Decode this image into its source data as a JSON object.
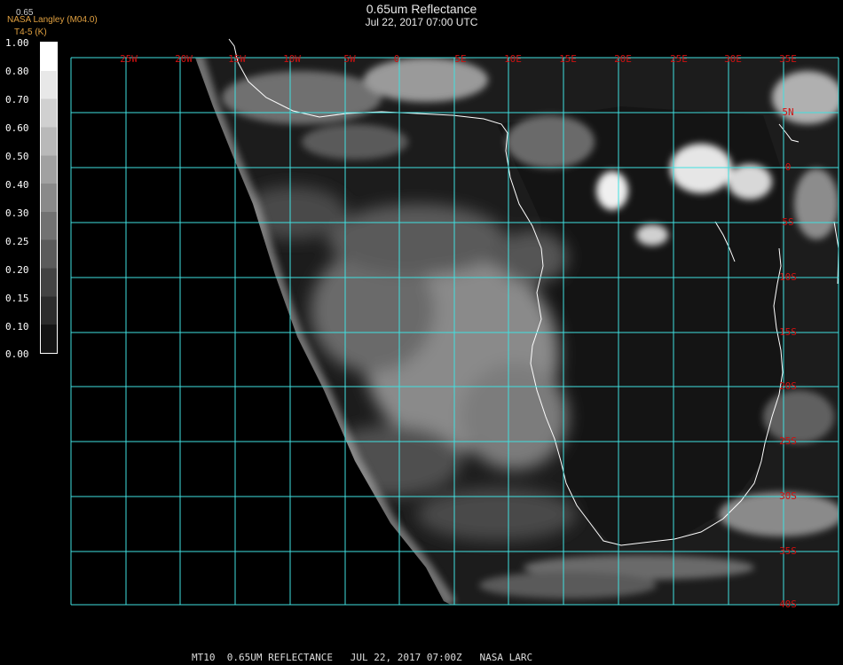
{
  "header": {
    "title": "0.65um Reflectance",
    "subtitle": "Jul 22, 2017 07:00 UTC",
    "credit": "NASA Langley (M04.0)",
    "product": "T4-5 (K)",
    "band": "0.65"
  },
  "colorbar": {
    "labels": [
      "1.00",
      "0.80",
      "0.70",
      "0.60",
      "0.50",
      "0.40",
      "0.30",
      "0.25",
      "0.20",
      "0.15",
      "0.10",
      "0.00"
    ]
  },
  "map": {
    "lon_labels": [
      "25W",
      "20W",
      "15W",
      "10W",
      "5W",
      "0",
      "5E",
      "10E",
      "15E",
      "20E",
      "25E",
      "30E",
      "35E"
    ],
    "lat_labels": [
      "5N",
      "0",
      "5S",
      "10S",
      "15S",
      "20S",
      "25S",
      "30S",
      "35S",
      "40S"
    ],
    "grid_color": "#40e0e0",
    "label_color": "#d01010",
    "coast_color": "#ffffff"
  },
  "footer": {
    "text": "MT10  0.65UM REFLECTANCE   JUL 22, 2017 07:00Z   NASA LARC"
  }
}
